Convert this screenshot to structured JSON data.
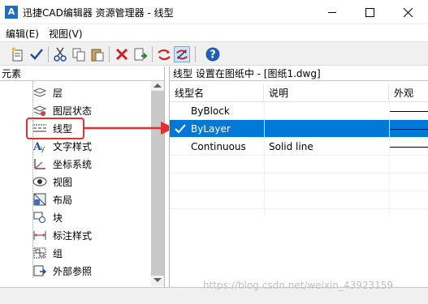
{
  "window": {
    "app_icon_letter": "A",
    "title": "迅捷CAD编辑器 资源管理器 - 线型"
  },
  "menu": {
    "edit": "编辑(E)",
    "view": "视图(V)"
  },
  "toolbar": {
    "icons": [
      "new-linetype-icon",
      "set-current-icon",
      "cut-icon",
      "copy-icon",
      "paste-icon",
      "delete-icon",
      "export-icon",
      "purge-icon",
      "regen-icon",
      "help-icon"
    ]
  },
  "left_panel": {
    "header": "元素",
    "items": [
      {
        "label": "层",
        "icon": "layer-icon"
      },
      {
        "label": "图层状态",
        "icon": "layer-state-icon"
      },
      {
        "label": "线型",
        "icon": "linetype-icon"
      },
      {
        "label": "文字样式",
        "icon": "text-style-icon"
      },
      {
        "label": "坐标系统",
        "icon": "ucs-icon"
      },
      {
        "label": "视图",
        "icon": "view-icon"
      },
      {
        "label": "布局",
        "icon": "layout-icon"
      },
      {
        "label": "块",
        "icon": "block-icon"
      },
      {
        "label": "标注样式",
        "icon": "dim-style-icon"
      },
      {
        "label": "组",
        "icon": "group-icon"
      },
      {
        "label": "外部参照",
        "icon": "xref-icon"
      }
    ],
    "selected_item": "线型"
  },
  "right_panel": {
    "header": "线型 设置在图纸中 - [图纸1.dwg]",
    "columns": [
      "线型名",
      "说明",
      "外观"
    ],
    "rows": [
      {
        "name": "ByBlock",
        "description": "",
        "current": false
      },
      {
        "name": "ByLayer",
        "description": "",
        "current": true
      },
      {
        "name": "Continuous",
        "description": "Solid line",
        "current": false
      }
    ]
  },
  "watermark": "https://blog.csdn.net/weixin_43923159",
  "colors": {
    "selection": "#0078d7",
    "annotation_red": "#e03030",
    "toolbar_bg": "#f0f0f0"
  }
}
